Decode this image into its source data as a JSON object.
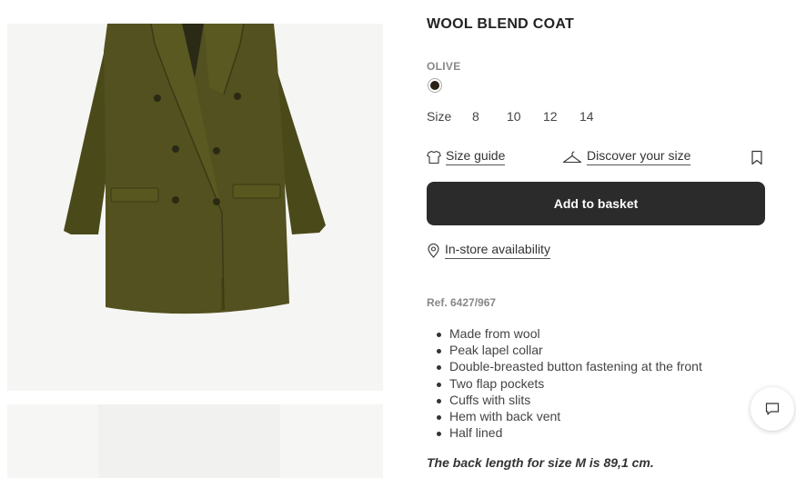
{
  "product": {
    "title": "WOOL BLEND COAT",
    "color_name": "OLIVE",
    "selected_color_hex": "#2a2117",
    "size_label": "Size",
    "sizes": [
      "8",
      "10",
      "12",
      "14"
    ],
    "ref": "Ref. 6427/967",
    "features": [
      "Made from wool",
      "Peak lapel collar",
      "Double-breasted button fastening at the front",
      "Two flap pockets",
      "Cuffs with slits",
      "Hem with back vent",
      "Half lined"
    ],
    "length_note": "The back length for size M is 89,1 cm."
  },
  "actions": {
    "size_guide": "Size guide",
    "discover_size": "Discover your size",
    "add_to_basket": "Add to basket",
    "in_store": "In-store availability"
  },
  "icons": {
    "size_guide": "tshirt-icon",
    "discover_size": "hanger-icon",
    "wishlist": "bookmark-icon",
    "in_store": "location-pin-icon",
    "chat": "chat-icon"
  },
  "colors": {
    "coat": "#4f4e1c",
    "button_bg": "#2b2b2b",
    "muted_text": "#888888"
  }
}
